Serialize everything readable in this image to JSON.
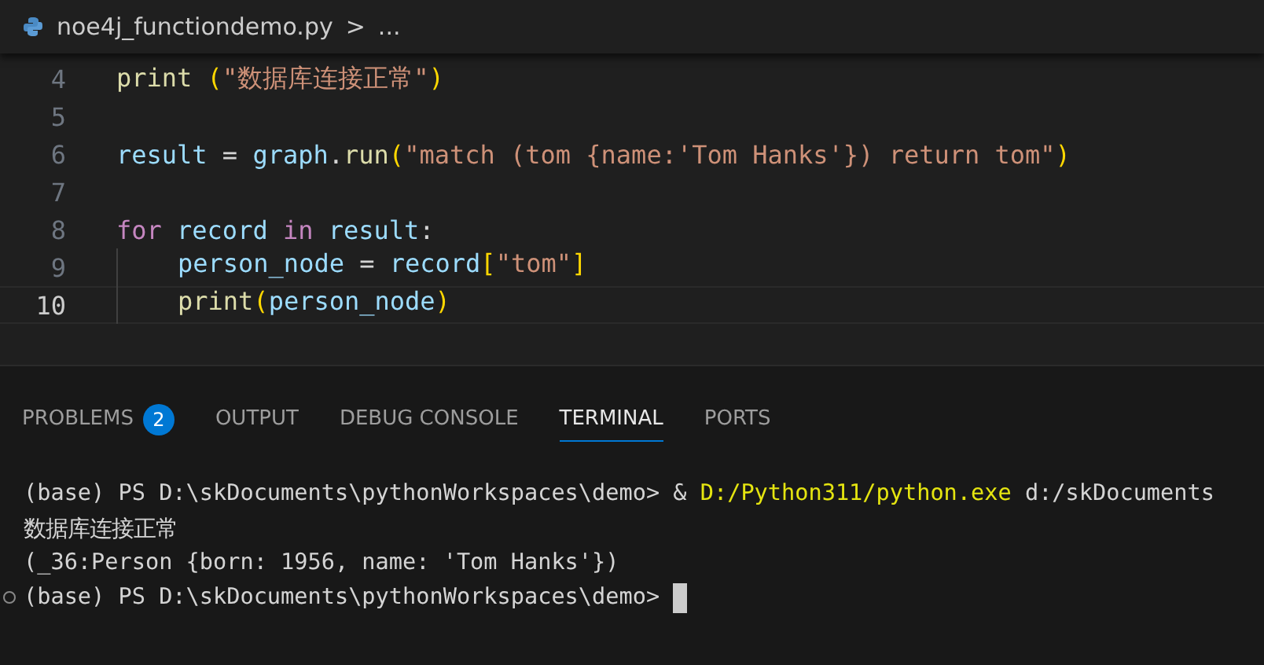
{
  "breadcrumb": {
    "file": "noe4j_functiondemo.py",
    "separator": ">",
    "more": "..."
  },
  "editor": {
    "lines": [
      {
        "number": "4",
        "current": false,
        "indent": false,
        "tokens": [
          {
            "kind": "func",
            "text": "print"
          },
          {
            "kind": "bracket",
            "text": " ("
          },
          {
            "kind": "string",
            "text": "\"数据库连接正常\""
          },
          {
            "kind": "bracket",
            "text": ")"
          }
        ]
      },
      {
        "number": "5",
        "current": false,
        "indent": false
      },
      {
        "number": "6",
        "current": false,
        "indent": false,
        "tokens": [
          {
            "kind": "var",
            "text": "result"
          },
          {
            "kind": "plain",
            "text": " = "
          },
          {
            "kind": "var",
            "text": "graph"
          },
          {
            "kind": "plain",
            "text": "."
          },
          {
            "kind": "func",
            "text": "run"
          },
          {
            "kind": "bracket",
            "text": "("
          },
          {
            "kind": "string",
            "text": "\"match (tom {name:'Tom Hanks'}) return tom\""
          },
          {
            "kind": "bracket",
            "text": ")"
          }
        ]
      },
      {
        "number": "7",
        "current": false,
        "indent": false
      },
      {
        "number": "8",
        "current": false,
        "indent": false,
        "tokens": [
          {
            "kind": "keyword",
            "text": "for "
          },
          {
            "kind": "var",
            "text": "record "
          },
          {
            "kind": "keyword2",
            "text": "in "
          },
          {
            "kind": "var",
            "text": "result"
          },
          {
            "kind": "plain",
            "text": ":"
          }
        ]
      },
      {
        "number": "9",
        "current": false,
        "indent": true,
        "tokens": [
          {
            "kind": "var",
            "text": "person_node"
          },
          {
            "kind": "plain",
            "text": " = "
          },
          {
            "kind": "var",
            "text": "record"
          },
          {
            "kind": "bracket",
            "text": "["
          },
          {
            "kind": "string",
            "text": "\"tom\""
          },
          {
            "kind": "bracket",
            "text": "]"
          }
        ]
      },
      {
        "number": "10",
        "current": true,
        "indent": true,
        "tokens": [
          {
            "kind": "func",
            "text": "print"
          },
          {
            "kind": "bracket",
            "text": "("
          },
          {
            "kind": "var",
            "text": "person_node"
          },
          {
            "kind": "bracket",
            "text": ")"
          }
        ]
      }
    ]
  },
  "panel": {
    "tabs": [
      {
        "label": "PROBLEMS",
        "badge": "2",
        "selected": false
      },
      {
        "label": "OUTPUT",
        "selected": false
      },
      {
        "label": "DEBUG CONSOLE",
        "selected": false
      },
      {
        "label": "TERMINAL",
        "selected": true
      },
      {
        "label": "PORTS",
        "selected": false
      }
    ],
    "terminal": [
      {
        "parts": [
          {
            "kind": "plain",
            "text": "(base) PS D:\\skDocuments\\pythonWorkspaces\\demo> & "
          },
          {
            "kind": "exe",
            "text": "D:/Python311/python.exe"
          },
          {
            "kind": "plain",
            "text": " d:/skDocuments"
          }
        ]
      },
      {
        "parts": [
          {
            "kind": "plain",
            "text": "数据库连接正常"
          }
        ]
      },
      {
        "parts": [
          {
            "kind": "plain",
            "text": "(_36:Person {born: 1956, name: 'Tom Hanks'})"
          }
        ]
      },
      {
        "marker": true,
        "cursor": true,
        "parts": [
          {
            "kind": "plain",
            "text": "(base) PS D:\\skDocuments\\pythonWorkspaces\\demo> "
          }
        ]
      }
    ]
  }
}
